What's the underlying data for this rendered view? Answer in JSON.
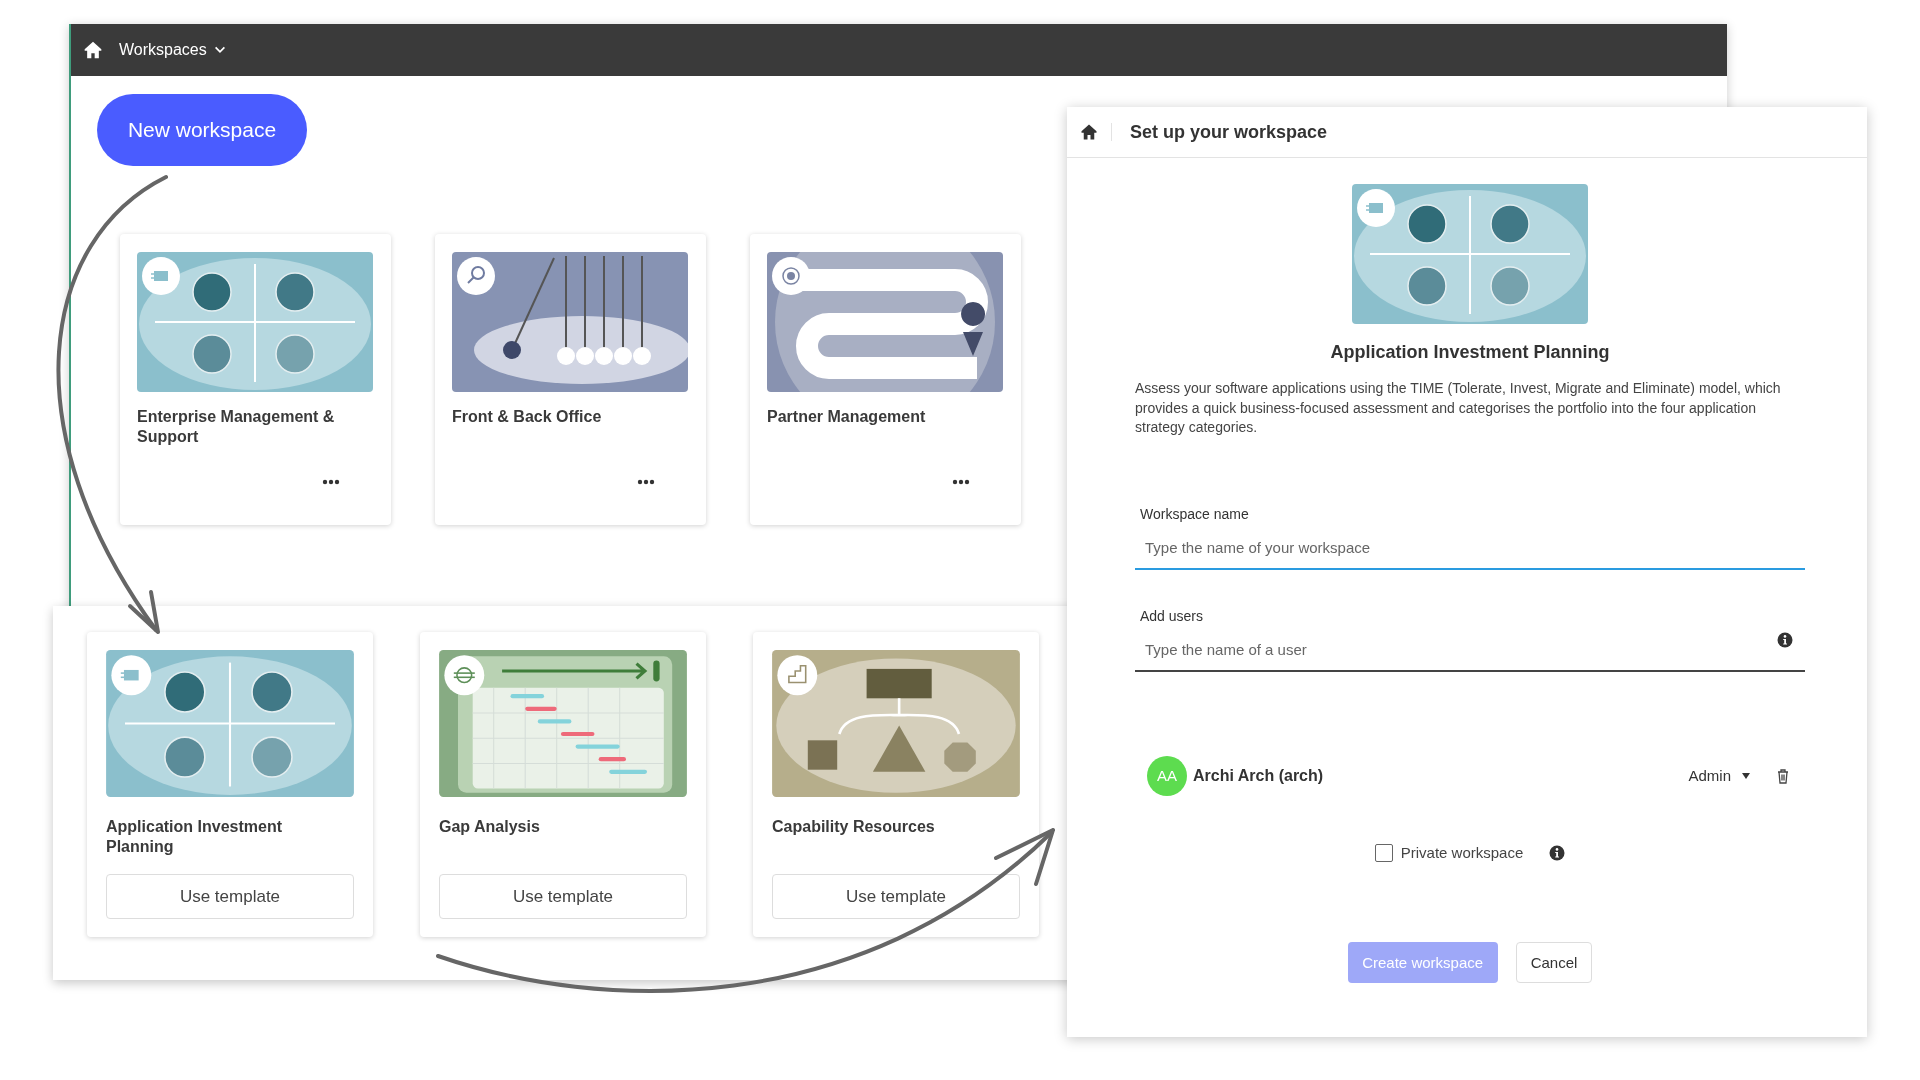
{
  "top_bar": {
    "menu_label": "Workspaces"
  },
  "new_workspace_button": "New workspace",
  "workspaces": [
    {
      "name": "Enterprise Management & Support",
      "kind": "quadrant"
    },
    {
      "name": "Front & Back Office",
      "kind": "pendulum"
    },
    {
      "name": "Partner Management",
      "kind": "winding-path"
    }
  ],
  "templates": [
    {
      "name": "Application Investment Planning",
      "kind": "quadrant",
      "button": "Use template"
    },
    {
      "name": "Gap Analysis",
      "kind": "gantt",
      "button": "Use template"
    },
    {
      "name": "Capability Resources",
      "kind": "hierarchy",
      "button": "Use template"
    }
  ],
  "dialog": {
    "title": "Set up your workspace",
    "kind": "quadrant",
    "template_name": "Application Investment Planning",
    "description": "Assess your software applications using the TIME (Tolerate, Invest, Migrate and Eliminate) model, which provides a quick business-focused assessment and categorises the portfolio into the four application strategy categories.",
    "fields": [
      {
        "label": "Workspace name",
        "placeholder": "Type the name of your workspace",
        "focused": true,
        "info": false
      },
      {
        "label": "Add users",
        "placeholder": "Type the name of a user",
        "focused": false,
        "info": true
      }
    ],
    "users": [
      {
        "initials": "AA",
        "name": "Archi Arch (arch)",
        "role": "Admin",
        "color": "#5ddc4f"
      }
    ],
    "private_workspace": {
      "label": "Private workspace",
      "checked": false
    },
    "buttons": [
      {
        "label": "Create workspace",
        "kind": "primary",
        "disabled": true
      },
      {
        "label": "Cancel",
        "kind": "secondary",
        "disabled": false
      }
    ]
  }
}
